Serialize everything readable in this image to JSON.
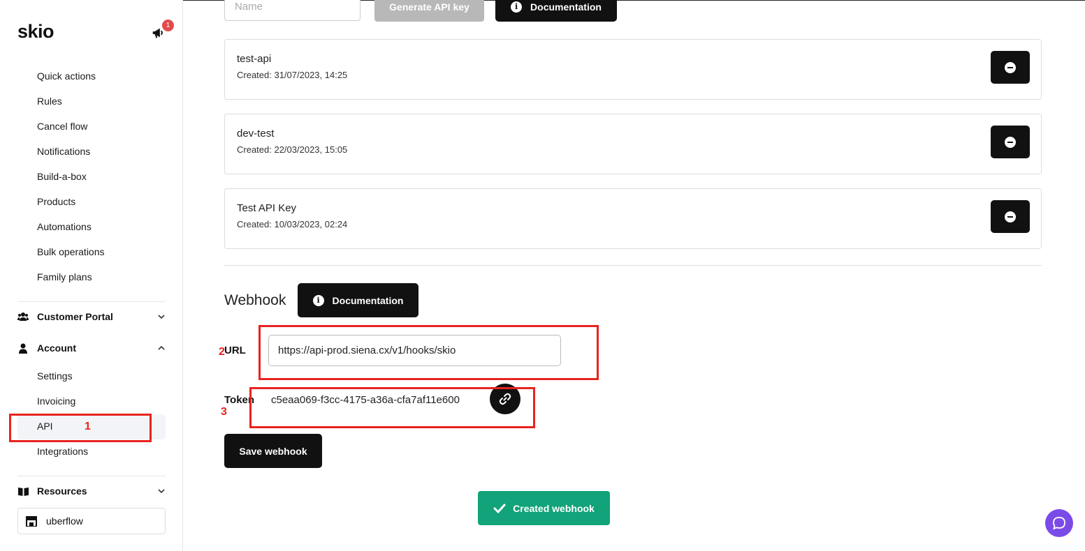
{
  "app": {
    "logo": "skio",
    "notification_count": "1"
  },
  "sidebar": {
    "rules_items": [
      "Quick actions",
      "Rules",
      "Cancel flow",
      "Notifications",
      "Build-a-box",
      "Products",
      "Automations",
      "Bulk operations",
      "Family plans"
    ],
    "customer_portal": "Customer Portal",
    "account": "Account",
    "account_items": [
      "Settings",
      "Invoicing",
      "API",
      "Integrations"
    ],
    "active_item": "API",
    "resources": "Resources",
    "store": "uberflow"
  },
  "api": {
    "name_placeholder": "Name",
    "generate_label": "Generate API key",
    "documentation_label": "Documentation",
    "keys": [
      {
        "name": "test-api",
        "created": "Created: 31/07/2023, 14:25"
      },
      {
        "name": "dev-test",
        "created": "Created: 22/03/2023, 15:05"
      },
      {
        "name": "Test API Key",
        "created": "Created: 10/03/2023, 02:24"
      }
    ]
  },
  "webhook": {
    "title": "Webhook",
    "documentation_label": "Documentation",
    "url_label": "URL",
    "url_value": "https://api-prod.siena.cx/v1/hooks/skio",
    "token_label": "Token",
    "token_value": "c5eaa069-f3cc-4175-a36a-cfa7af11e600",
    "save_label": "Save webhook"
  },
  "toast": {
    "message": "Created webhook",
    "color": "#12a37a"
  },
  "annotations": [
    "1",
    "2",
    "3"
  ],
  "colors": {
    "accent": "#111111",
    "annotation": "#e8231f",
    "chat": "#7b4be8"
  }
}
